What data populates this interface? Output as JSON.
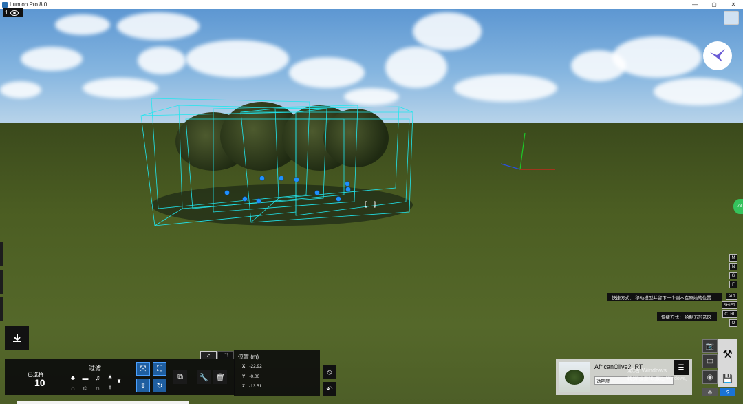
{
  "window": {
    "title": "Lumion Pro 8.0",
    "controls": [
      "—",
      "▢",
      "✕"
    ]
  },
  "viewport": {
    "camera_badge": "1",
    "eye_icon": "eye-icon"
  },
  "green_tab_text": "73",
  "side_keys": [
    "M",
    "N",
    "G",
    "F"
  ],
  "modifier_keys": {
    "alt": "ALT",
    "shift": "SHIFT",
    "ctrl": "CTRL",
    "o": "O"
  },
  "hints": {
    "alt_hint": "快捷方式：  移动模型并留下一个副本在原始的位置",
    "ctrl_hint": "快捷方式：  绘制方形选区"
  },
  "selection": {
    "label": "已选择",
    "count": "10",
    "filter_label": "过滤"
  },
  "position": {
    "title": "位置 (m)",
    "x_label": "X",
    "x_value": "-22.92",
    "y_label": "Y",
    "y_value": "-0.00",
    "z_label": "Z",
    "z_value": "-13.51"
  },
  "object": {
    "name": "AfricanOlive2_RT",
    "field_text": "透明度"
  },
  "watermark": {
    "line1": "激活 Windows",
    "line2": "转到\"设置\"以激活 Windows。"
  }
}
